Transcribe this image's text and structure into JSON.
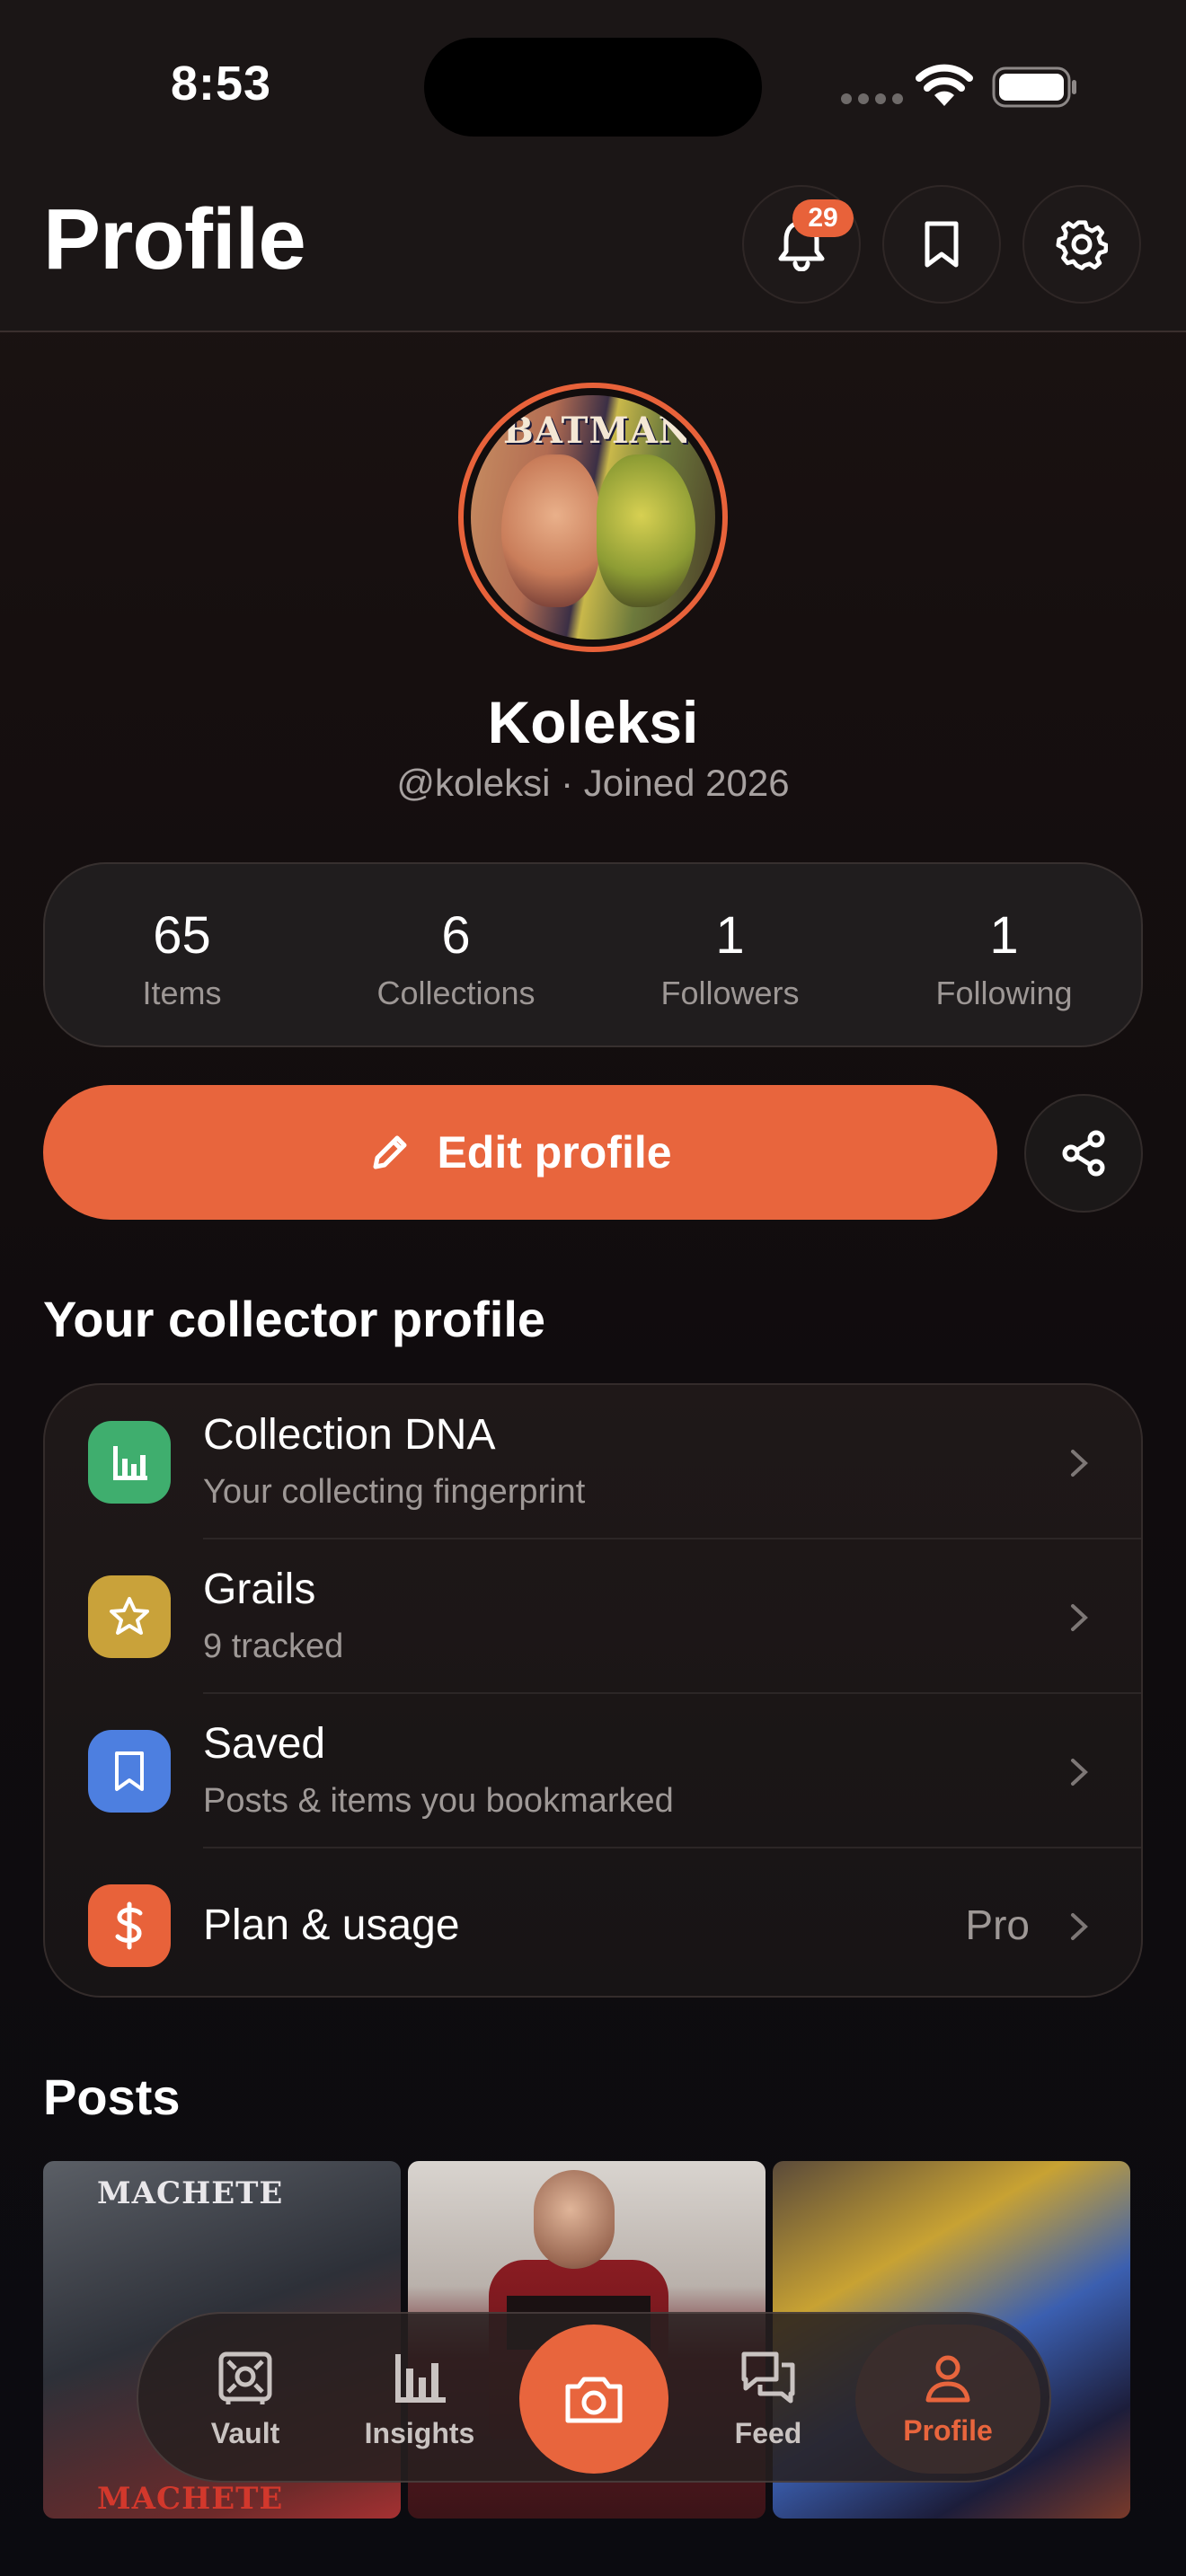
{
  "status_bar": {
    "time": "8:53"
  },
  "header": {
    "title": "Profile",
    "notification_count": "29"
  },
  "profile": {
    "display_name": "Koleksi",
    "handle_joined": "@koleksi · Joined 2026",
    "avatar_text": "BATMAN"
  },
  "stats": [
    {
      "value": "65",
      "label": "Items"
    },
    {
      "value": "6",
      "label": "Collections"
    },
    {
      "value": "1",
      "label": "Followers"
    },
    {
      "value": "1",
      "label": "Following"
    }
  ],
  "actions": {
    "edit_label": "Edit profile"
  },
  "collector_section": {
    "title": "Your collector profile",
    "rows": [
      {
        "title": "Collection DNA",
        "subtitle": "Your collecting fingerprint",
        "icon": "bar-chart-icon",
        "color": "#3fae6e"
      },
      {
        "title": "Grails",
        "subtitle": "9 tracked",
        "icon": "star-icon",
        "color": "#c9a23a"
      },
      {
        "title": "Saved",
        "subtitle": "Posts & items you bookmarked",
        "icon": "bookmark-icon",
        "color": "#4d7fe0"
      },
      {
        "title": "Plan & usage",
        "value": "Pro",
        "icon": "dollar-icon",
        "color": "#e8623a"
      }
    ]
  },
  "posts_section": {
    "title": "Posts",
    "posts": [
      {
        "label_top": "MACHETE",
        "label_bottom": "MACHETE"
      },
      {
        "label_top": ""
      },
      {
        "label_top": ""
      }
    ]
  },
  "tab_bar": {
    "tabs": [
      {
        "label": "Vault",
        "icon": "vault-icon"
      },
      {
        "label": "Insights",
        "icon": "insights-icon"
      },
      {
        "label": "Camera",
        "icon": "camera-icon"
      },
      {
        "label": "Feed",
        "icon": "chat-bubbles-icon"
      },
      {
        "label": "Profile",
        "icon": "person-icon",
        "active": true
      }
    ]
  },
  "colors": {
    "accent": "#e8653d",
    "background": "#120e0f",
    "card": "#1f1a1a"
  }
}
